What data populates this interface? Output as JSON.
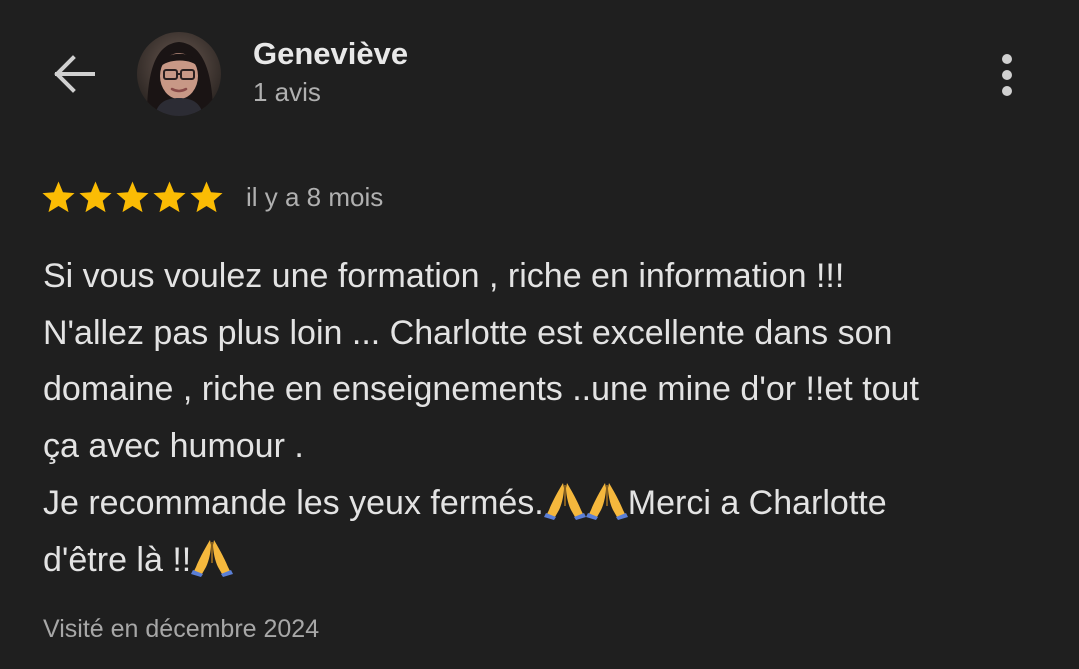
{
  "header": {
    "back_icon": "arrow-left-icon",
    "author_name": "Geneviève",
    "author_reviews": "1 avis",
    "more_icon": "more-vertical-icon"
  },
  "review": {
    "rating": 5,
    "rating_max": 5,
    "star_icon": "star-icon",
    "star_color": "#fbbc04",
    "date": "il y a 8 mois",
    "lines": [
      "Si vous voulez une formation , riche en information !!!",
      "N'allez pas plus loin ... Charlotte est excellente dans son",
      "domaine , riche en enseignements ..une mine d'or !!et tout",
      "ça avec humour ."
    ],
    "line5_part1": "Je recommande les yeux fermés.",
    "line5_part2": "Merci a Charlotte",
    "line6_part1": "d'être là !!",
    "emoji_icon": "folded-hands-emoji",
    "visit": "Visité en décembre 2024"
  },
  "colors": {
    "background": "#1f1f1f",
    "text_primary": "#e3e3e3",
    "text_secondary": "#b0b0b0"
  }
}
